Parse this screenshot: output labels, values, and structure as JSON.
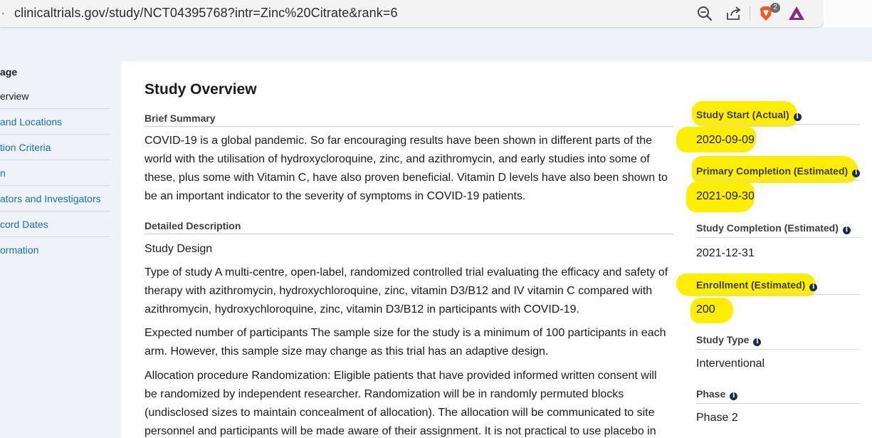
{
  "browser": {
    "lead_char": ".",
    "url": "clinicaltrials.gov/study/NCT04395768?intr=Zinc%20Citrate&rank=6",
    "brave_badge": "2",
    "icons": [
      "zoom-icon",
      "share-icon",
      "brave-shield-icon",
      "brave-rewards-icon"
    ]
  },
  "leftnav": {
    "title": "age",
    "items": [
      {
        "label": "erview"
      },
      {
        "label": " and Locations"
      },
      {
        "label": "tion Criteria"
      },
      {
        "label": "n"
      },
      {
        "label": "ators and Investigators"
      },
      {
        "label": "cord Dates"
      },
      {
        "label": "ormation"
      }
    ]
  },
  "main": {
    "title": "Study Overview",
    "brief_summary_label": "Brief Summary",
    "brief_summary": [
      "COVID-19 is a global pandemic. So far encouraging results have been shown in different parts of the",
      "world with the utilisation of hydroxycloroquine, zinc, and azithromycin, and early studies into some of",
      "these, plus some with Vitamin C, have also proven beneficial. Vitamin D levels have also been shown to",
      "be an important indicator to the severity of symptoms in COVID-19 patients."
    ],
    "detailed_label": "Detailed Description",
    "study_design": "Study Design",
    "type_of_study": [
      "Type of study A multi-centre, open-label, randomized controlled trial evaluating the efficacy and safety of",
      "therapy with azithromycin, hydroxychloroquine, zinc, vitamin D3/B12 and IV vitamin C compared with",
      "azithromycin, hydroxychloroquine, zinc, vitamin D3/B12 in participants with COVID-19."
    ],
    "expected": [
      "Expected number of participants The sample size for the study is a minimum of 100 participants in each",
      "arm. However, this sample size may change as this trial has an adaptive design."
    ],
    "allocation": [
      "Allocation procedure Randomization: Eligible patients that have provided informed written consent will",
      "be randomized by independent researcher. Randomization will be in randomly permuted blocks",
      "(undisclosed sizes to maintain concealment of allocation). The allocation will be communicated to site",
      "personnel and participants will be made aware of their assignment. It is not practical to use placebo in"
    ]
  },
  "meta": {
    "study_start_label": "Study Start (Actual)",
    "study_start": "2020-09-09",
    "primary_completion_label": "Primary Completion (Estimated)",
    "primary_completion": "2021-09-30",
    "study_completion_label": "Study Completion (Estimated)",
    "study_completion": "2021-12-31",
    "enrollment_label": "Enrollment (Estimated)",
    "enrollment": "200",
    "study_type_label": "Study Type",
    "study_type": "Interventional",
    "phase_label": "Phase",
    "phase": "Phase 2",
    "info_glyph": "i"
  },
  "colors": {
    "highlight": "#ffee00",
    "link": "#1a6fa8",
    "page_bg": "#eef3fa"
  }
}
